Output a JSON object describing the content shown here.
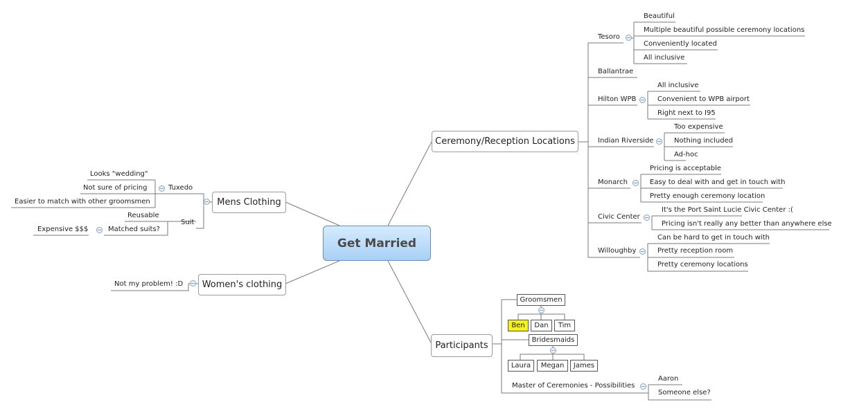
{
  "central": "Get Married",
  "topics": {
    "locations": "Ceremony/Reception Locations",
    "participants": "Participants",
    "mens": "Mens Clothing",
    "womens": "Women's clothing"
  },
  "locations": {
    "tesoro": {
      "label": "Tesoro",
      "items": [
        "Beautiful",
        "Multiple beautiful possible ceremony locations",
        "Conveniently located",
        "All inclusive"
      ]
    },
    "ballantrae": {
      "label": "Ballantrae"
    },
    "hilton": {
      "label": "Hilton WPB",
      "items": [
        "All inclusive",
        "Convenient to WPB airport",
        "Right next to I95"
      ]
    },
    "indian": {
      "label": "Indian Riverside",
      "items": [
        "Too expensive",
        "Nothing included",
        "Ad-hoc"
      ]
    },
    "monarch": {
      "label": "Monarch",
      "items": [
        "Pricing is acceptable",
        "Easy to deal with and get in touch with",
        "Pretty enough ceremony location"
      ]
    },
    "civic": {
      "label": "Civic Center",
      "items": [
        "It's the Port Saint Lucie Civic Center :(",
        "Pricing isn't really any better than anywhere else"
      ]
    },
    "willoughby": {
      "label": "Willoughby",
      "items": [
        "Can be hard to get in touch with",
        "Pretty reception room",
        "Pretty ceremony locations"
      ]
    }
  },
  "participants": {
    "groomsmen": {
      "label": "Groomsmen",
      "members": [
        "Ben",
        "Dan",
        "Tim"
      ]
    },
    "bridesmaids": {
      "label": "Bridesmaids",
      "members": [
        "Laura",
        "Megan",
        "James"
      ]
    },
    "mc": {
      "label": "Master of Ceremonies - Possibilities",
      "items": [
        "Aaron",
        "Someone else?"
      ]
    }
  },
  "mens": {
    "tuxedo": {
      "label": "Tuxedo",
      "items": [
        "Looks \"wedding\"",
        "Not sure of pricing",
        "Easier to match with other groomsmen"
      ]
    },
    "suit": {
      "label": "Suit",
      "items": [
        "Reusable"
      ]
    },
    "matched": {
      "label": "Matched suits?",
      "items": [
        "Expensive $$$"
      ]
    }
  },
  "womens": {
    "items": [
      "Not my problem! :D"
    ]
  },
  "collapse_glyph": "−"
}
